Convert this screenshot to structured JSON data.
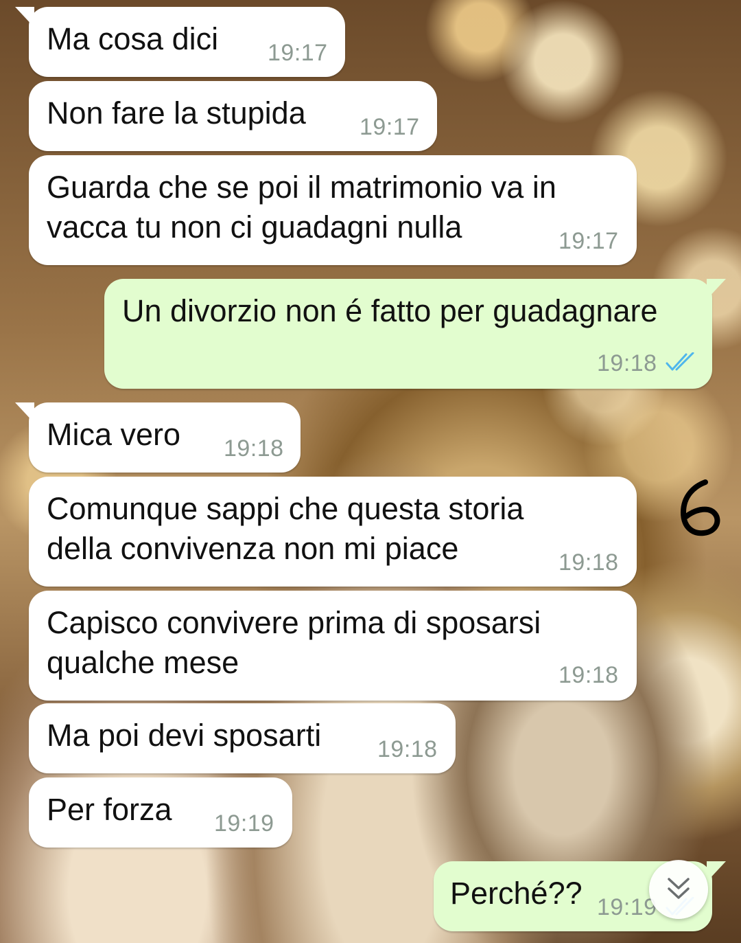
{
  "messages": [
    {
      "text": "Ma cosa dici",
      "time": "19:17",
      "direction": "incoming"
    },
    {
      "text": "Non fare la stupida",
      "time": "19:17",
      "direction": "incoming"
    },
    {
      "text": "Guarda che se poi il matrimonio va in\nvacca tu non ci guadagni nulla",
      "time": "19:17",
      "direction": "incoming"
    },
    {
      "text": "Un divorzio non é fatto per guadagnare",
      "time": "19:18",
      "direction": "outgoing",
      "status": "read"
    },
    {
      "text": "Mica vero",
      "time": "19:18",
      "direction": "incoming"
    },
    {
      "text": "Comunque sappi che questa storia\ndella convivenza non mi piace",
      "time": "19:18",
      "direction": "incoming"
    },
    {
      "text": "Capisco convivere prima di sposarsi\nqualche mese",
      "time": "19:18",
      "direction": "incoming"
    },
    {
      "text": "Ma poi devi sposarti",
      "time": "19:18",
      "direction": "incoming"
    },
    {
      "text": "Per forza",
      "time": "19:19",
      "direction": "incoming"
    },
    {
      "text": "Perché??",
      "time": "19:19",
      "direction": "outgoing",
      "status": "read"
    }
  ],
  "annotation": "6",
  "icons": {
    "read_receipt": "double-check-icon",
    "scroll_button": "chevron-double-down-icon"
  },
  "colors": {
    "incoming_bubble": "#ffffff",
    "outgoing_bubble": "#e2fdcf",
    "timestamp": "#8d9a92",
    "read_ticks": "#4fb6ec"
  }
}
